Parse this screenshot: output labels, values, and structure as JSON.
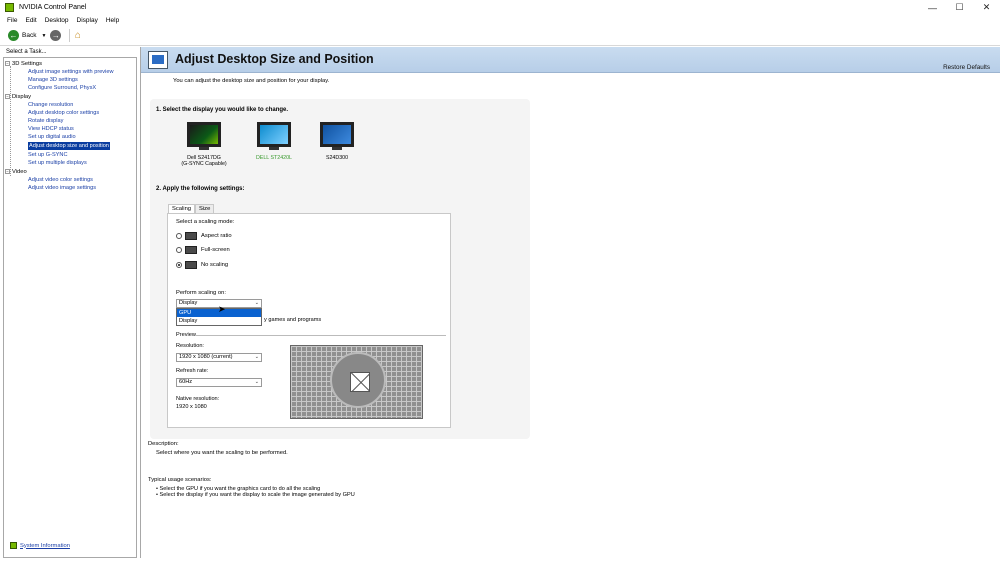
{
  "window": {
    "title": "NVIDIA Control Panel",
    "minimize": "—",
    "maximize": "☐",
    "close": "✕"
  },
  "menu": [
    "File",
    "Edit",
    "Desktop",
    "Display",
    "Help"
  ],
  "toolbar": {
    "back_label": "Back"
  },
  "sidebar": {
    "header": "Select a Task...",
    "groups": [
      {
        "label": "3D Settings",
        "items": [
          "Adjust image settings with preview",
          "Manage 3D settings",
          "Configure Surround, PhysX"
        ]
      },
      {
        "label": "Display",
        "items": [
          "Change resolution",
          "Adjust desktop color settings",
          "Rotate display",
          "View HDCP status",
          "Set up digital audio",
          "Adjust desktop size and position",
          "Set up G-SYNC",
          "Set up multiple displays"
        ]
      },
      {
        "label": "Video",
        "items": [
          "Adjust video color settings",
          "Adjust video image settings"
        ]
      }
    ],
    "selected": "Adjust desktop size and position",
    "system_info": "System Information"
  },
  "page": {
    "title": "Adjust Desktop Size and Position",
    "restore_defaults": "Restore Defaults",
    "intro": "You can adjust the desktop size and position for your display.",
    "step1": "1. Select the display you would like to change.",
    "displays": [
      {
        "name": "Dell S2417DG\n(G-SYNC Capable)",
        "selected": false
      },
      {
        "name": "DELL ST2420L",
        "selected": true
      },
      {
        "name": "S24D300",
        "selected": false
      }
    ],
    "step2": "2. Apply the following settings:",
    "tabs": [
      "Scaling",
      "Size"
    ],
    "active_tab": "Scaling",
    "scaling": {
      "mode_label": "Select a scaling mode:",
      "modes": [
        {
          "label": "Aspect ratio",
          "checked": false
        },
        {
          "label": "Full-screen",
          "checked": false
        },
        {
          "label": "No scaling",
          "checked": true
        }
      ],
      "perform_label": "Perform scaling on:",
      "perform_value": "Display",
      "perform_options": [
        "GPU",
        "Display"
      ],
      "highlighted_option": "GPU",
      "override_text": "y games and programs"
    },
    "preview": {
      "label": "Preview",
      "resolution_label": "Resolution:",
      "resolution_value": "1920 x 1080 (current)",
      "refresh_label": "Refresh rate:",
      "refresh_value": "60Hz",
      "native_label": "Native resolution:",
      "native_value": "1920 x 1080"
    },
    "description_label": "Description:",
    "description_text": "Select where you want the scaling to be performed.",
    "usage_label": "Typical usage scenarios:",
    "usage_items": [
      "• Select the GPU if you want the graphics card to do all the scaling",
      "• Select the display if you want the display to scale the image generated by GPU"
    ]
  }
}
